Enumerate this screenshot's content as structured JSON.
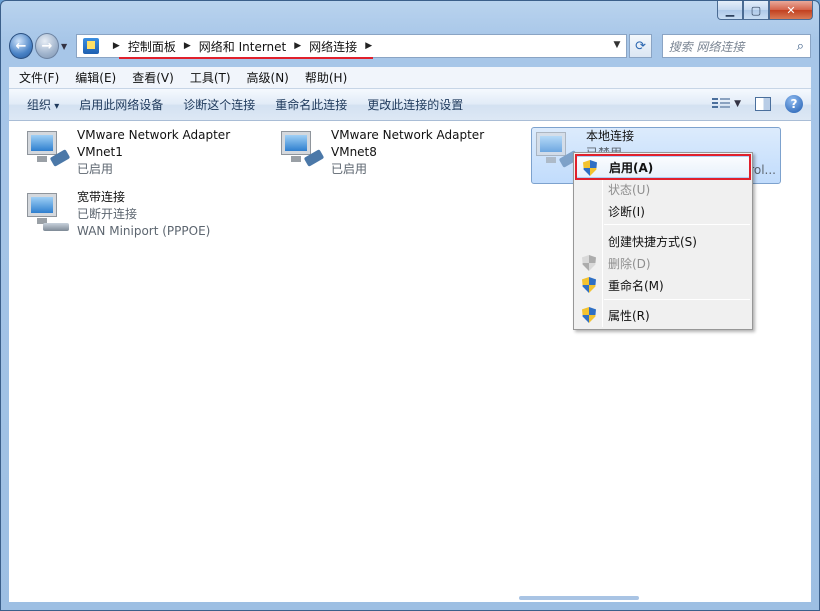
{
  "address": {
    "crumbs": [
      "控制面板",
      "网络和 Internet",
      "网络连接"
    ]
  },
  "search": {
    "placeholder": "搜索 网络连接"
  },
  "menubar": [
    "文件(F)",
    "编辑(E)",
    "查看(V)",
    "工具(T)",
    "高级(N)",
    "帮助(H)"
  ],
  "commandbar": [
    "组织",
    "启用此网络设备",
    "诊断这个连接",
    "重命名此连接",
    "更改此连接的设置"
  ],
  "connections": [
    {
      "name": "VMware Network Adapter",
      "line2": "VMnet1",
      "status": "已启用"
    },
    {
      "name": "VMware Network Adapter",
      "line2": "VMnet8",
      "status": "已启用"
    },
    {
      "name": "本地连接",
      "line2": "已禁用",
      "status": "...rol..."
    },
    {
      "name": "宽带连接",
      "status": "已断开连接",
      "device": "WAN Miniport (PPPOE)"
    }
  ],
  "context_menu": [
    {
      "label": "启用(A)",
      "icon": "shield-icon",
      "bold": true,
      "disabled": false
    },
    {
      "label": "状态(U)",
      "disabled": true
    },
    {
      "label": "诊断(I)",
      "disabled": false
    },
    {
      "label": "创建快捷方式(S)",
      "disabled": false
    },
    {
      "label": "删除(D)",
      "icon": "shield-icon",
      "disabled": true
    },
    {
      "label": "重命名(M)",
      "icon": "shield-icon",
      "disabled": false
    },
    {
      "label": "属性(R)",
      "icon": "shield-icon",
      "disabled": false
    }
  ],
  "colors": {
    "highlight_box": "#e0202c",
    "selection": "#c1dcfc"
  }
}
